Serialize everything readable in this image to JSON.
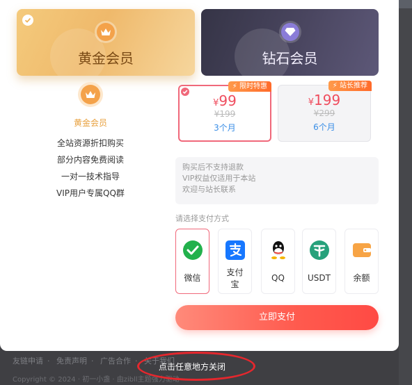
{
  "cards": {
    "gold": {
      "title": "黄金会员",
      "icon": "crown-icon"
    },
    "diamond": {
      "title": "钻石会员",
      "icon": "diamond-icon"
    }
  },
  "benefits": {
    "level_name": "黄金会员",
    "items": [
      "全站资源折扣购买",
      "部分内容免费阅读",
      "一对一技术指导",
      "VIP用户专属QQ群"
    ]
  },
  "prices": [
    {
      "tag": "⚡ 限时特惠",
      "currency": "¥",
      "amount": "99",
      "original": "¥199",
      "period": "3个月",
      "selected": true
    },
    {
      "tag": "⚡ 站长推荐",
      "currency": "¥",
      "amount": "199",
      "original": "¥299",
      "period": "6个月",
      "selected": false
    }
  ],
  "notice": [
    "购买后不支持退款",
    "VIP权益仅适用于本站",
    "欢迎与站长联系"
  ],
  "pay": {
    "title": "请选择支付方式",
    "methods": [
      {
        "label": "微信",
        "icon": "wechat-pay-icon"
      },
      {
        "label": "支付宝",
        "label_line1": "支付",
        "label_line2": "宝",
        "icon": "alipay-icon"
      },
      {
        "label": "QQ",
        "icon": "qq-icon"
      },
      {
        "label": "USDT",
        "icon": "usdt-icon"
      },
      {
        "label": "余额",
        "icon": "wallet-icon"
      }
    ],
    "button": "立即支付"
  },
  "footer": {
    "links": [
      "友链申请",
      "免责声明",
      "广告合作",
      "关于我们"
    ],
    "copyright": "Copyright © 2024 · 初一小盏 · 由zibll主题强力驱动"
  },
  "overlay": {
    "close_hint": "点击任意地方关闭"
  },
  "colors": {
    "accent": "#ef4d5e",
    "gold": "#e8a13f",
    "link": "#3a8ee6",
    "annotation": "#e5272d"
  }
}
